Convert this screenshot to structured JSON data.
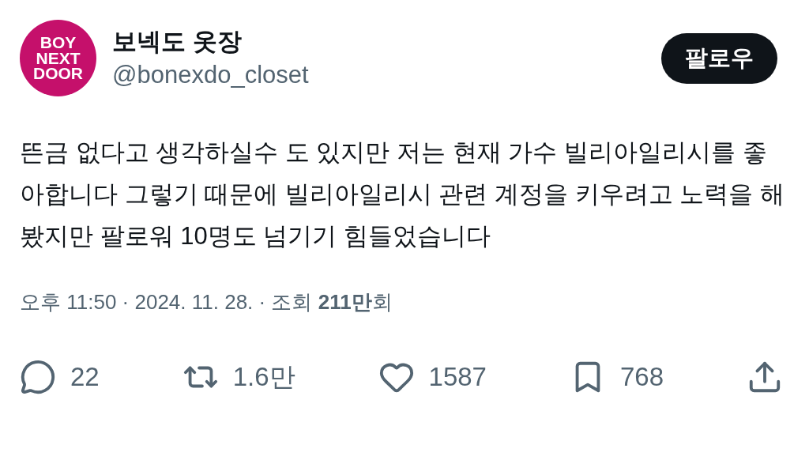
{
  "author": {
    "avatar_lines": [
      "BOY",
      "NEXT",
      "DOOR"
    ],
    "name": "보넥도 옷장",
    "handle": "@bonexdo_closet"
  },
  "follow_button": {
    "label": "팔로우"
  },
  "post": {
    "text": "뜬금 없다고 생각하실수 도 있지만 저는 현재 가수 빌리아일리시를 좋아합니다 그렇기 때문에 빌리아일리시 관련 계정을 키우려고 노력을 해봤지만 팔로워 10명도 넘기기 힘들었습니다"
  },
  "meta": "오후 11:50 · 2024. 11. 28. · 조회 **211만**회",
  "actions": [
    {
      "kind": "reply",
      "count": "22"
    },
    {
      "kind": "repost",
      "count": "1.6만"
    },
    {
      "kind": "like",
      "count": "1587"
    },
    {
      "kind": "bookmark",
      "count": "768"
    },
    {
      "kind": "share"
    }
  ]
}
